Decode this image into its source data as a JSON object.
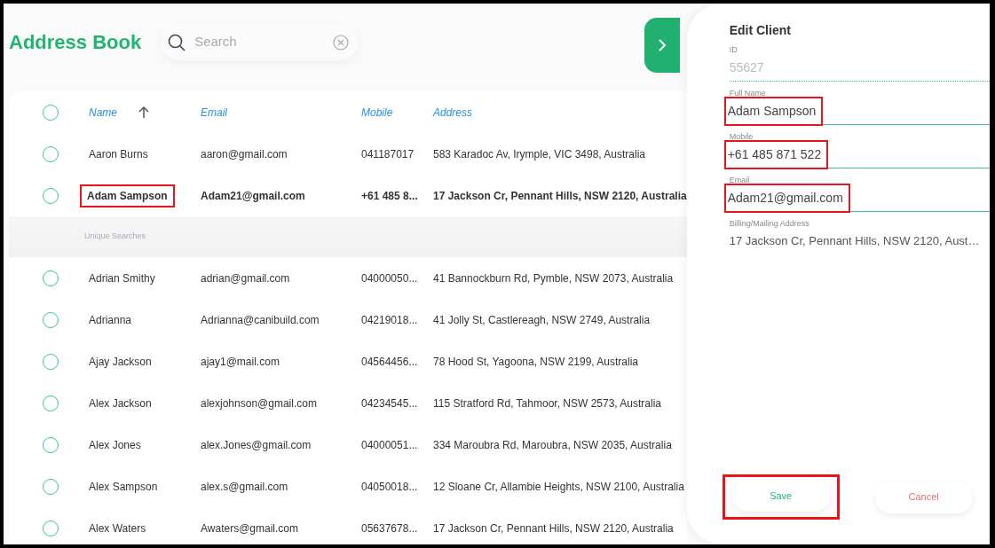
{
  "title": "Address Book",
  "search": {
    "placeholder": "Search"
  },
  "table": {
    "all_checked": false,
    "columns": [
      {
        "label": "Name",
        "sorted": true
      },
      {
        "label": "Email",
        "sorted": false
      },
      {
        "label": "Mobile",
        "sorted": false
      },
      {
        "label": "Address",
        "sorted": false
      }
    ],
    "rows": [
      {
        "kind": "contact",
        "name": "Aaron Burns",
        "email": "aaron@gmail.com",
        "mobile": "041187017",
        "address": "583 Karadoc Av, Irymple, VIC 3498, Australia",
        "selected": false,
        "checked": false,
        "highlighted": false
      },
      {
        "kind": "contact",
        "name": "Adam Sampson",
        "email": "Adam21@gmail.com",
        "mobile": "+61 485 8...",
        "address": "17 Jackson Cr, Pennant Hills, NSW 2120, Australia",
        "selected": true,
        "checked": false,
        "highlighted": true
      },
      {
        "kind": "section",
        "label": "Unique Searches"
      },
      {
        "kind": "contact",
        "name": "Adrian Smithy",
        "email": "adrian@gmail.com",
        "mobile": "04000050...",
        "address": "41 Bannockburn Rd, Pymble, NSW 2073, Australia",
        "selected": false,
        "checked": false,
        "highlighted": false
      },
      {
        "kind": "contact",
        "name": "Adrianna",
        "email": "Adrianna@canibuild.com",
        "mobile": "04219018...",
        "address": "41 Jolly St, Castlereagh, NSW 2749, Australia",
        "selected": false,
        "checked": false,
        "highlighted": false
      },
      {
        "kind": "contact",
        "name": "Ajay Jackson",
        "email": "ajay1@mail.com",
        "mobile": "04564456...",
        "address": "78 Hood St, Yagoona, NSW 2199, Australia",
        "selected": false,
        "checked": false,
        "highlighted": false
      },
      {
        "kind": "contact",
        "name": "Alex Jackson",
        "email": "alexjohnson@gmail.com",
        "mobile": "04234545...",
        "address": "115 Stratford Rd, Tahmoor, NSW 2573, Australia",
        "selected": false,
        "checked": false,
        "highlighted": false
      },
      {
        "kind": "contact",
        "name": "Alex Jones",
        "email": "alex.Jones@gmail.com",
        "mobile": "04000051...",
        "address": "334 Maroubra Rd, Maroubra, NSW 2035, Australia",
        "selected": false,
        "checked": false,
        "highlighted": false
      },
      {
        "kind": "contact",
        "name": "Alex Sampson",
        "email": "alex.s@gmail.com",
        "mobile": "04050018...",
        "address": "12 Sloane Cr, Allambie Heights, NSW 2100, Australia",
        "selected": false,
        "checked": false,
        "highlighted": false
      },
      {
        "kind": "contact",
        "name": "Alex Waters",
        "email": "Awaters@gmail.com",
        "mobile": "05637678...",
        "address": "17 Jackson Cr, Pennant Hills, NSW 2120, Australia",
        "selected": false,
        "checked": false,
        "highlighted": false
      }
    ]
  },
  "panel": {
    "title": "Edit Client",
    "fields": [
      {
        "kind": "readonly",
        "label": "ID",
        "value": "55627",
        "highlighted": false
      },
      {
        "kind": "input",
        "label": "Full Name",
        "value": "Adam  Sampson",
        "highlighted": true
      },
      {
        "kind": "input",
        "label": "Mobile",
        "value": "+61 485 871 522",
        "highlighted": true
      },
      {
        "kind": "input",
        "label": "Email",
        "value": "Adam21@gmail.com",
        "highlighted": true
      },
      {
        "kind": "text",
        "label": "Billing/Mailing Address",
        "value": "17 Jackson Cr, Pennant Hills, NSW 2120, Aust…",
        "highlighted": false
      }
    ],
    "buttons": [
      {
        "kind": "save",
        "label": "Save",
        "highlighted": true
      },
      {
        "kind": "cancel",
        "label": "Cancel",
        "highlighted": false
      }
    ]
  }
}
